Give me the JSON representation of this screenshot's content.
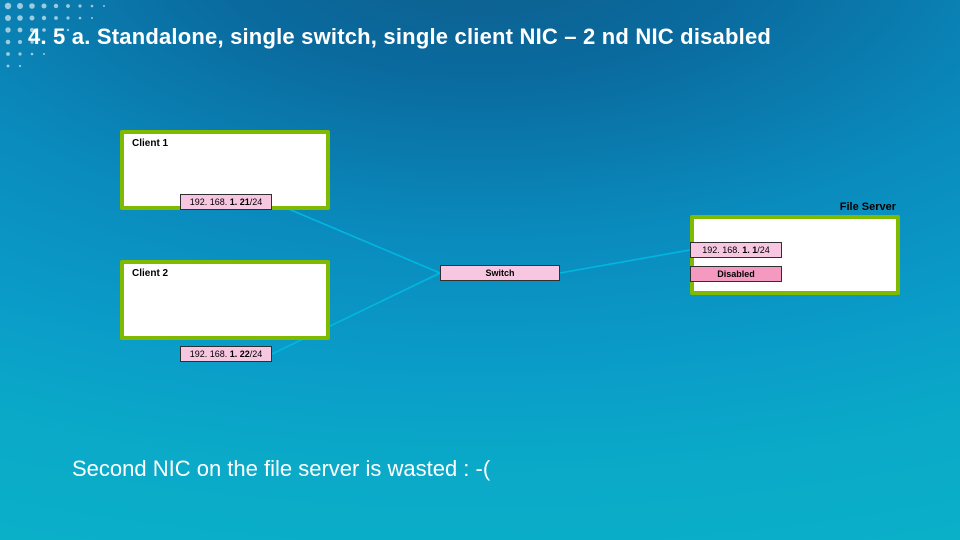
{
  "title": "4. 5 a. Standalone, single switch, single client NIC – 2 nd NIC disabled",
  "client1": {
    "label": "Client 1",
    "nic_pre": "192. 168. ",
    "nic_bold": "1. 21",
    "nic_post": "/24"
  },
  "client2": {
    "label": "Client 2",
    "nic_pre": "192. 168. ",
    "nic_bold": "1. 22",
    "nic_post": "/24"
  },
  "switch": {
    "label": "Switch"
  },
  "server": {
    "label": "File Server",
    "nic1_pre": "192. 168. ",
    "nic1_bold": "1. 1",
    "nic1_post": "/24",
    "nic2": "Disabled"
  },
  "caption": "Second NIC on the file server is wasted  : -(",
  "colors": {
    "accent": "#7fba00",
    "nic": "#f7c6e0",
    "line": "#00a3c7"
  }
}
